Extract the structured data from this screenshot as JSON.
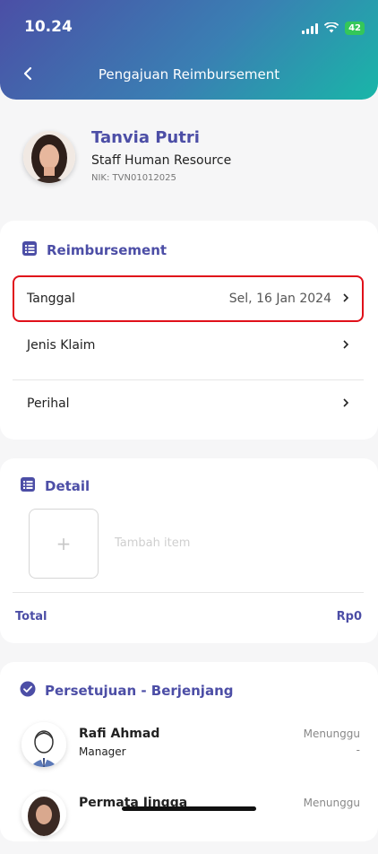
{
  "status_bar": {
    "time": "10.24",
    "battery": "42"
  },
  "header": {
    "title": "Pengajuan Reimbursement"
  },
  "profile": {
    "name": "Tanvia Putri",
    "role": "Staff Human Resource",
    "nik": "NIK: TVN01012025"
  },
  "reimbursement": {
    "section_title": "Reimbursement",
    "rows": [
      {
        "label": "Tanggal",
        "value": "Sel, 16 Jan 2024"
      },
      {
        "label": "Jenis Klaim",
        "value": ""
      },
      {
        "label": "Perihal",
        "value": ""
      }
    ]
  },
  "detail": {
    "section_title": "Detail",
    "add_plus": "+",
    "add_label": "Tambah item",
    "total_label": "Total",
    "total_value": "Rp0"
  },
  "approval": {
    "section_title": "Persetujuan - Berjenjang",
    "approvers": [
      {
        "name": "Rafi Ahmad",
        "role": "Manager",
        "status": "Menunggu",
        "date": "-"
      },
      {
        "name": "Permata Jingga",
        "role": "",
        "status": "Menunggu",
        "date": ""
      }
    ]
  }
}
